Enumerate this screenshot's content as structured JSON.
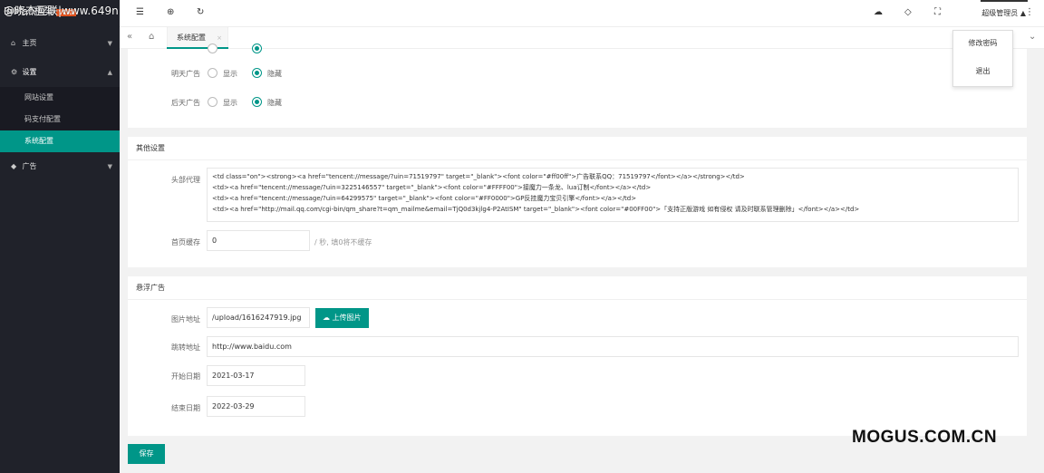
{
  "watermark_top": "@晓杰互联|www.649n",
  "watermark_bottom": "MOGUS.COM.CN",
  "sidebar": {
    "logo_text": "BiMao框架",
    "version": "V1.0",
    "items": [
      {
        "label": "主页",
        "icon": "home-icon"
      },
      {
        "label": "设置",
        "icon": "gear-icon"
      },
      {
        "label": "广告",
        "icon": "diamond-icon"
      }
    ],
    "sub_items": [
      "网站设置",
      "码支付配置",
      "系统配置"
    ],
    "active_sub": "系统配置"
  },
  "header": {
    "admin_label": "超级管理员"
  },
  "tabs": {
    "active_tab": "系统配置"
  },
  "dropdown": {
    "items": [
      "修改密码",
      "退出"
    ]
  },
  "ads_card": {
    "rows": [
      {
        "label": "明天广告",
        "opt1": "显示",
        "opt2": "隐藏",
        "selected": "隐藏"
      },
      {
        "label": "后天广告",
        "opt1": "显示",
        "opt2": "隐藏",
        "selected": "隐藏"
      }
    ]
  },
  "other_settings": {
    "title": "其他设置",
    "header_code_label": "头部代理",
    "header_code": "<td class=\"on\"><strong><a href=\"tencent://message/?uin=71519797\" target=\"_blank\"><font color=\"#ff00ff\">广告联系QQ：71519797</font></a></strong></td>\n<td><a href=\"tencent://message/?uin=3225146557\" target=\"_blank\"><font color=\"#FFFF00\">接魔力一条龙、lua订制</font></a></td>\n<td><a href=\"tencent://message/?uin=64299575\" target=\"_blank\"><font color=\"#FF0000\">GP反挂魔力宝贝引擎</font></a></td>\n<td><a href=\"http://mail.qq.com/cgi-bin/qm_share?t=qm_mailme&email=TjQ0d3kjlg4-P2AtISM\" target=\"_blank\"><font color=\"#00FF00\">「支持正版游戏 如有侵权 请及时联系管理删除」</font></a></td>",
    "cache_label": "首页缓存",
    "cache_value": "0",
    "cache_hint": "/ 秒, 填0将不缓存"
  },
  "float_ad": {
    "title": "悬浮广告",
    "image_label": "图片地址",
    "image_value": "/upload/1616247919.jpg",
    "upload_label": "上传图片",
    "link_label": "跳转地址",
    "link_value": "http://www.baidu.com",
    "start_label": "开始日期",
    "start_value": "2021-03-17",
    "end_label": "结束日期",
    "end_value": "2022-03-29"
  },
  "save_label": "保存",
  "colors": {
    "accent": "#009688",
    "sidebar_bg": "#20222a"
  }
}
